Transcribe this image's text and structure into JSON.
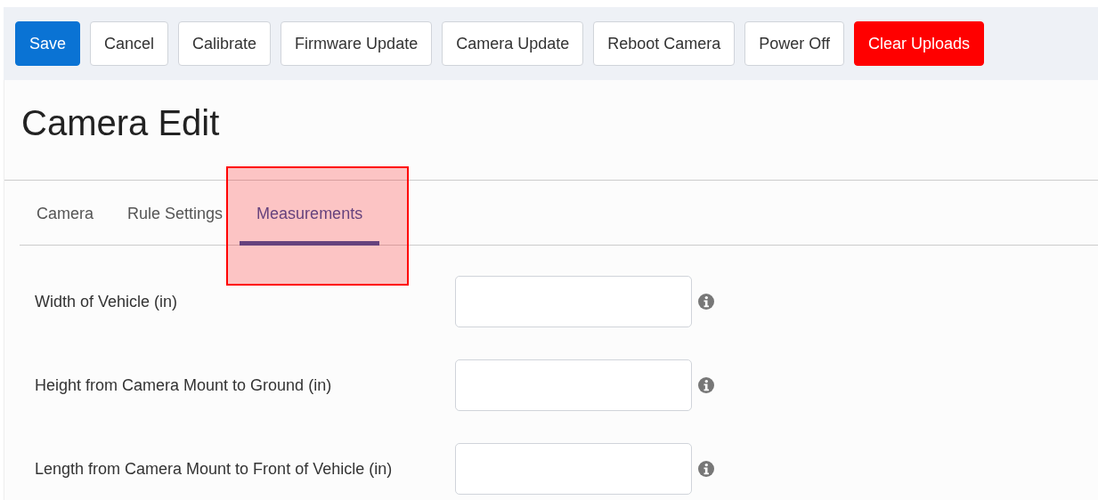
{
  "toolbar": {
    "buttons": [
      {
        "label": "Save",
        "kind": "primary"
      },
      {
        "label": "Cancel",
        "kind": "default"
      },
      {
        "label": "Calibrate",
        "kind": "default"
      },
      {
        "label": "Firmware Update",
        "kind": "default"
      },
      {
        "label": "Camera Update",
        "kind": "default"
      },
      {
        "label": "Reboot Camera",
        "kind": "default"
      },
      {
        "label": "Power Off",
        "kind": "default"
      },
      {
        "label": "Clear Uploads",
        "kind": "danger"
      }
    ]
  },
  "page_title": "Camera Edit",
  "tabs": [
    {
      "label": "Camera",
      "selected": false,
      "highlighted": false
    },
    {
      "label": "Rule Settings",
      "selected": false,
      "highlighted": false
    },
    {
      "label": "Measurements",
      "selected": true,
      "highlighted": true
    }
  ],
  "fields": [
    {
      "label": "Width of Vehicle (in)"
    },
    {
      "label": "Height from Camera Mount to Ground (in)"
    },
    {
      "label": "Length from Camera Mount to Front of Vehicle (in)"
    }
  ]
}
